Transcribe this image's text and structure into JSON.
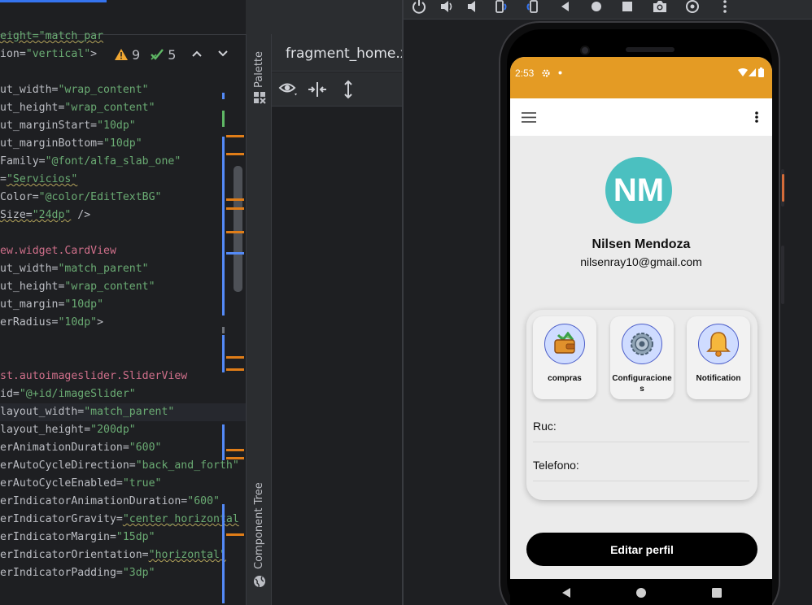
{
  "editor": {
    "inspections": {
      "warnings": "9",
      "weak_warnings": "5"
    },
    "lines": [
      {
        "parts": [
          {
            "t": "eight=\"match_par",
            "c": "c-str wavy"
          }
        ]
      },
      {
        "parts": [
          {
            "t": "ion=",
            "c": "c-attr"
          },
          {
            "t": "\"vertical\"",
            "c": "c-str"
          },
          {
            "t": ">",
            "c": "c-attr"
          }
        ]
      },
      {
        "parts": []
      },
      {
        "parts": [
          {
            "t": "ut_width=",
            "c": "c-attr"
          },
          {
            "t": "\"wrap_content\"",
            "c": "c-str"
          }
        ]
      },
      {
        "parts": [
          {
            "t": "ut_height=",
            "c": "c-attr"
          },
          {
            "t": "\"wrap_content\"",
            "c": "c-str"
          }
        ]
      },
      {
        "parts": [
          {
            "t": "ut_marginStart=",
            "c": "c-attr"
          },
          {
            "t": "\"10dp\"",
            "c": "c-str"
          }
        ]
      },
      {
        "parts": [
          {
            "t": "ut_marginBottom=",
            "c": "c-attr"
          },
          {
            "t": "\"10dp\"",
            "c": "c-str"
          }
        ]
      },
      {
        "parts": [
          {
            "t": "Family=",
            "c": "c-attr"
          },
          {
            "t": "\"@font/alfa_slab_one\"",
            "c": "c-str"
          }
        ]
      },
      {
        "parts": [
          {
            "t": "=",
            "c": "c-attr"
          },
          {
            "t": "\"Servicios\"",
            "c": "c-str wavy"
          }
        ]
      },
      {
        "parts": [
          {
            "t": "Color=",
            "c": "c-attr"
          },
          {
            "t": "\"@color/EditTextBG\"",
            "c": "c-str"
          }
        ]
      },
      {
        "parts": [
          {
            "t": "Size=",
            "c": "c-attr wavy"
          },
          {
            "t": "\"24dp\"",
            "c": "c-str wavy"
          },
          {
            "t": " />",
            "c": "c-attr"
          }
        ]
      },
      {
        "parts": []
      },
      {
        "parts": [
          {
            "t": "ew.widget.CardView",
            "c": "c-red"
          }
        ]
      },
      {
        "parts": [
          {
            "t": "ut_width=",
            "c": "c-attr"
          },
          {
            "t": "\"match_parent\"",
            "c": "c-str"
          }
        ]
      },
      {
        "parts": [
          {
            "t": "ut_height=",
            "c": "c-attr"
          },
          {
            "t": "\"wrap_content\"",
            "c": "c-str"
          }
        ]
      },
      {
        "parts": [
          {
            "t": "ut_margin=",
            "c": "c-attr"
          },
          {
            "t": "\"10dp\"",
            "c": "c-str"
          }
        ]
      },
      {
        "parts": [
          {
            "t": "erRadius=",
            "c": "c-attr"
          },
          {
            "t": "\"10dp\"",
            "c": "c-str"
          },
          {
            "t": ">",
            "c": "c-attr"
          }
        ]
      },
      {
        "parts": []
      },
      {
        "parts": []
      },
      {
        "parts": [
          {
            "t": "st.autoimageslider.SliderView",
            "c": "c-red"
          }
        ]
      },
      {
        "parts": [
          {
            "t": "id=",
            "c": "c-attr"
          },
          {
            "t": "\"@+id/imageSlider\"",
            "c": "c-str"
          }
        ]
      },
      {
        "parts": [
          {
            "t": "layout_width=",
            "c": "c-attr"
          },
          {
            "t": "\"match_parent\"",
            "c": "c-str"
          }
        ],
        "hl": true
      },
      {
        "parts": [
          {
            "t": "layout_height=",
            "c": "c-attr"
          },
          {
            "t": "\"200dp\"",
            "c": "c-str"
          }
        ]
      },
      {
        "parts": [
          {
            "t": "erAnimationDuration=",
            "c": "c-attr"
          },
          {
            "t": "\"600\"",
            "c": "c-str"
          }
        ]
      },
      {
        "parts": [
          {
            "t": "erAutoCycleDirection=",
            "c": "c-attr"
          },
          {
            "t": "\"back_and_forth\"",
            "c": "c-str"
          }
        ]
      },
      {
        "parts": [
          {
            "t": "erAutoCycleEnabled=",
            "c": "c-attr"
          },
          {
            "t": "\"true\"",
            "c": "c-str"
          }
        ]
      },
      {
        "parts": [
          {
            "t": "erIndicatorAnimationDuration=",
            "c": "c-attr"
          },
          {
            "t": "\"600\"",
            "c": "c-str"
          }
        ]
      },
      {
        "parts": [
          {
            "t": "erIndicatorGravity=",
            "c": "c-attr"
          },
          {
            "t": "\"center_horizontal",
            "c": "c-str wavy"
          }
        ]
      },
      {
        "parts": [
          {
            "t": "erIndicatorMargin=",
            "c": "c-attr"
          },
          {
            "t": "\"15dp\"",
            "c": "c-str"
          }
        ]
      },
      {
        "parts": [
          {
            "t": "erIndicatorOrientation=",
            "c": "c-attr"
          },
          {
            "t": "\"horizontal\"",
            "c": "c-str wavy"
          }
        ]
      },
      {
        "parts": [
          {
            "t": "erIndicatorPadding=",
            "c": "c-attr"
          },
          {
            "t": "\"3dp\"",
            "c": "c-str"
          }
        ]
      }
    ]
  },
  "side_tools": {
    "palette": "Palette",
    "component_tree": "Component Tree"
  },
  "design": {
    "file_tab": "fragment_home.xml"
  },
  "emulator": {
    "status_time": "2:53",
    "colors": {
      "status_bar": "#e49b24",
      "avatar": "#4bc0c0",
      "tile_icon_bg": "#cfdcff"
    },
    "profile": {
      "initials": "NM",
      "name": "Nilsen Mendoza",
      "email": "nilsenray10@gmail.com"
    },
    "tiles": [
      {
        "label": "compras",
        "icon": "wallet-icon"
      },
      {
        "label": "Configuraciones",
        "icon": "gear-icon"
      },
      {
        "label": "Notification",
        "icon": "bell-icon"
      }
    ],
    "fields": [
      {
        "label": "Ruc:"
      },
      {
        "label": "Telefono:"
      }
    ],
    "edit_button": "Editar perfil"
  }
}
